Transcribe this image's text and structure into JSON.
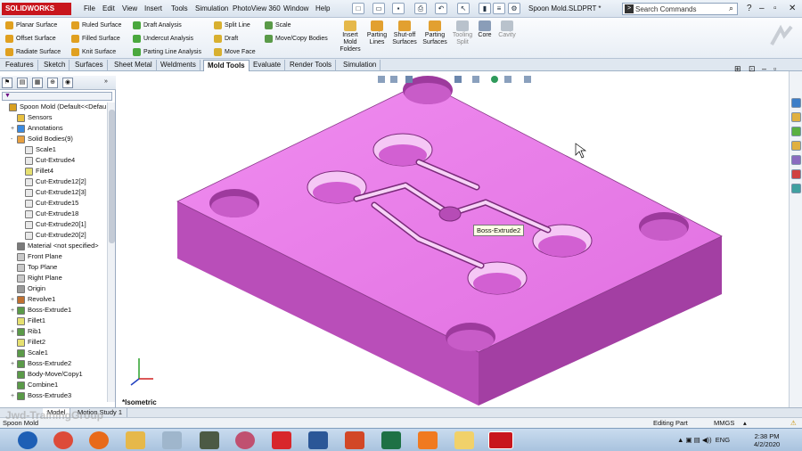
{
  "app": {
    "logo": "SOLIDWORKS",
    "filename": "Spoon Mold.SLDPRT *"
  },
  "menu": [
    "File",
    "Edit",
    "View",
    "Insert",
    "Tools",
    "Simulation",
    "PhotoView 360",
    "Window",
    "Help"
  ],
  "search": {
    "placeholder": "Search Commands"
  },
  "ribbon": {
    "col1": [
      "Planar Surface",
      "Offset Surface",
      "Radiate Surface"
    ],
    "col2": [
      "Ruled Surface",
      "Filled Surface",
      "Knit Surface"
    ],
    "col3": [
      "Draft Analysis",
      "Undercut Analysis",
      "Parting Line Analysis"
    ],
    "col4": [
      "Split Line",
      "Draft",
      "Move Face"
    ],
    "col5": [
      "Scale",
      "Move/Copy Bodies"
    ],
    "big": [
      "Insert Mold Folders",
      "Parting Lines",
      "Shut-off Surfaces",
      "Parting Surfaces",
      "Tooling Split",
      "Core",
      "Cavity"
    ]
  },
  "tabs": [
    "Features",
    "Sketch",
    "Surfaces",
    "Sheet Metal",
    "Weldments",
    "Mold Tools",
    "Evaluate",
    "Render Tools",
    "Simulation"
  ],
  "active_tab": "Mold Tools",
  "tree": [
    {
      "label": "Spoon Mold  (Default<<Defau",
      "indent": 0,
      "expand": ""
    },
    {
      "label": "Sensors",
      "indent": 1,
      "expand": ""
    },
    {
      "label": "Annotations",
      "indent": 1,
      "expand": "+"
    },
    {
      "label": "Solid Bodies(9)",
      "indent": 1,
      "expand": "-"
    },
    {
      "label": "Scale1",
      "indent": 2,
      "expand": ""
    },
    {
      "label": "Cut-Extrude4",
      "indent": 2,
      "expand": ""
    },
    {
      "label": "Fillet4",
      "indent": 2,
      "expand": ""
    },
    {
      "label": "Cut-Extrude12[2]",
      "indent": 2,
      "expand": ""
    },
    {
      "label": "Cut-Extrude12[3]",
      "indent": 2,
      "expand": ""
    },
    {
      "label": "Cut-Extrude15",
      "indent": 2,
      "expand": ""
    },
    {
      "label": "Cut-Extrude18",
      "indent": 2,
      "expand": ""
    },
    {
      "label": "Cut-Extrude20[1]",
      "indent": 2,
      "expand": ""
    },
    {
      "label": "Cut-Extrude20[2]",
      "indent": 2,
      "expand": ""
    },
    {
      "label": "Material <not specified>",
      "indent": 1,
      "expand": ""
    },
    {
      "label": "Front Plane",
      "indent": 1,
      "expand": ""
    },
    {
      "label": "Top Plane",
      "indent": 1,
      "expand": ""
    },
    {
      "label": "Right Plane",
      "indent": 1,
      "expand": ""
    },
    {
      "label": "Origin",
      "indent": 1,
      "expand": ""
    },
    {
      "label": "Revolve1",
      "indent": 1,
      "expand": "+"
    },
    {
      "label": "Boss-Extrude1",
      "indent": 1,
      "expand": "+"
    },
    {
      "label": "Fillet1",
      "indent": 1,
      "expand": ""
    },
    {
      "label": "Rib1",
      "indent": 1,
      "expand": "+"
    },
    {
      "label": "Fillet2",
      "indent": 1,
      "expand": ""
    },
    {
      "label": "Scale1",
      "indent": 1,
      "expand": ""
    },
    {
      "label": "Boss-Extrude2",
      "indent": 1,
      "expand": "+"
    },
    {
      "label": "Body-Move/Copy1",
      "indent": 1,
      "expand": ""
    },
    {
      "label": "Combine1",
      "indent": 1,
      "expand": ""
    },
    {
      "label": "Boss-Extrude3",
      "indent": 1,
      "expand": "+"
    }
  ],
  "viewport": {
    "view_label": "*Isometric",
    "tooltip": "Boss-Extrude2",
    "mold_color": "#e879e8"
  },
  "bottom_tabs": [
    "Model",
    "Motion Study 1"
  ],
  "status": {
    "left": "Spoon Mold",
    "mode": "Editing Part",
    "units": "MMGS"
  },
  "watermark": "Jwd-TrainingGroup",
  "taskbar": {
    "lang": "ENG",
    "time": "2:38 PM",
    "date": "4/2/2020"
  }
}
